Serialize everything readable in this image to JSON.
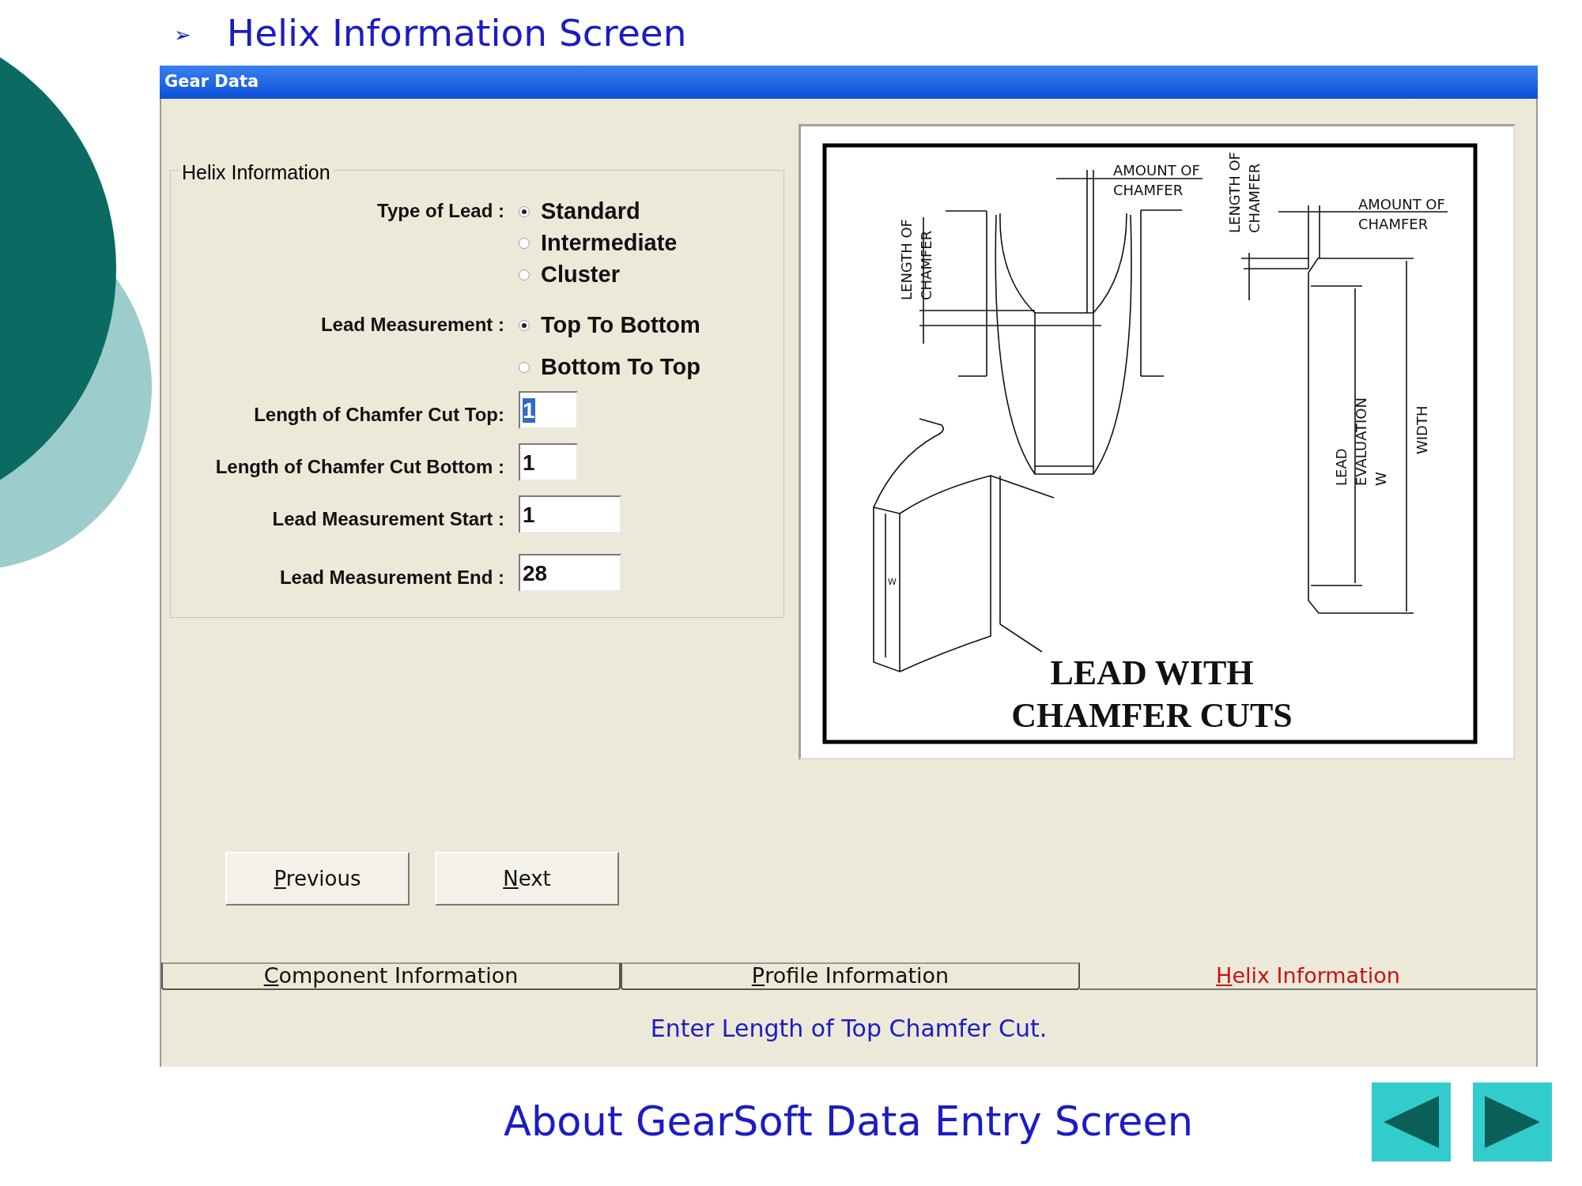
{
  "slide_heading": {
    "bullet": "➢",
    "text": "Helix Information Screen"
  },
  "window": {
    "title": "Gear Data"
  },
  "helix_group": {
    "title": "Helix Information",
    "radio_groups": [
      {
        "label": "Type of Lead :",
        "options": [
          {
            "label": "Standard",
            "selected": true
          },
          {
            "label": "Intermediate",
            "selected": false
          },
          {
            "label": "Cluster",
            "selected": false
          }
        ]
      },
      {
        "label": "Lead Measurement :",
        "options": [
          {
            "label": "Top To Bottom",
            "selected": true
          },
          {
            "label": "Bottom To Top",
            "selected": false
          }
        ]
      }
    ],
    "fields": [
      {
        "label": "Length of Chamfer Cut Top:",
        "value": "1",
        "text_selected": true
      },
      {
        "label": "Length of Chamfer Cut Bottom :",
        "value": "1",
        "text_selected": false
      },
      {
        "label": "Lead Measurement Start :",
        "value": "1",
        "text_selected": false
      },
      {
        "label": "Lead Measurement End :",
        "value": "28",
        "text_selected": false
      }
    ]
  },
  "diagram": {
    "dimension_labels": [
      {
        "lines": [
          "AMOUNT OF",
          "CHAMFER"
        ]
      },
      {
        "lines": [
          "AMOUNT OF",
          "CHAMFER"
        ]
      },
      {
        "lines": [
          "LENGTH OF",
          "CHAMFER"
        ]
      },
      {
        "lines": [
          "LENGTH OF",
          "CHAMFER"
        ]
      },
      {
        "lines": [
          "LEAD",
          "EVALUATION",
          "W"
        ]
      },
      {
        "lines": [
          "WIDTH"
        ]
      },
      {
        "lines": [
          "W"
        ]
      }
    ],
    "caption": [
      "LEAD WITH",
      "CHAMFER CUTS"
    ]
  },
  "buttons": [
    {
      "label": "Previous",
      "accelerator_underlined": true
    },
    {
      "label": "Next",
      "accelerator_underlined": true
    }
  ],
  "tabs": [
    {
      "label": "Component Information",
      "selected": false
    },
    {
      "label": "Profile Information",
      "selected": false
    },
    {
      "label": "Helix Information",
      "selected": true
    }
  ],
  "status_bar": "Enter Length of Top Chamfer Cut.",
  "slide_footer": {
    "text": "About GearSoft Data Entry Screen"
  }
}
